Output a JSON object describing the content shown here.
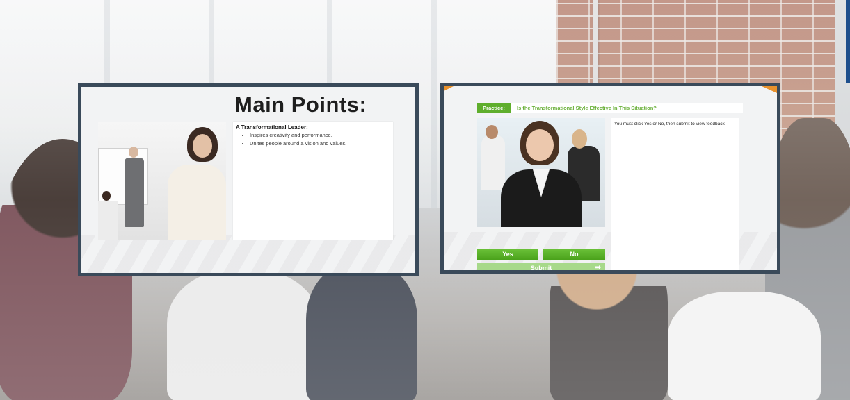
{
  "left_slide": {
    "title": "Main Points:",
    "heading": "A Transformational Leader:",
    "bullets": [
      "Inspires creativity and performance.",
      "Unites people around a vision and values."
    ]
  },
  "right_slide": {
    "practice_label": "Practice:",
    "question": "Is the Transformational Style Effective In This Situation?",
    "yes_label": "Yes",
    "no_label": "No",
    "submit_label": "Submit",
    "instruction": "You must click Yes or No, then submit to view feedback.",
    "submit_icon": "arrow-right-icon"
  },
  "colors": {
    "accent_green": "#5fae2c",
    "question_green": "#6ab03a",
    "submit_disabled": "#a7d98a",
    "frame": "#3a4a5a",
    "corner_orange": "#e8912c"
  }
}
